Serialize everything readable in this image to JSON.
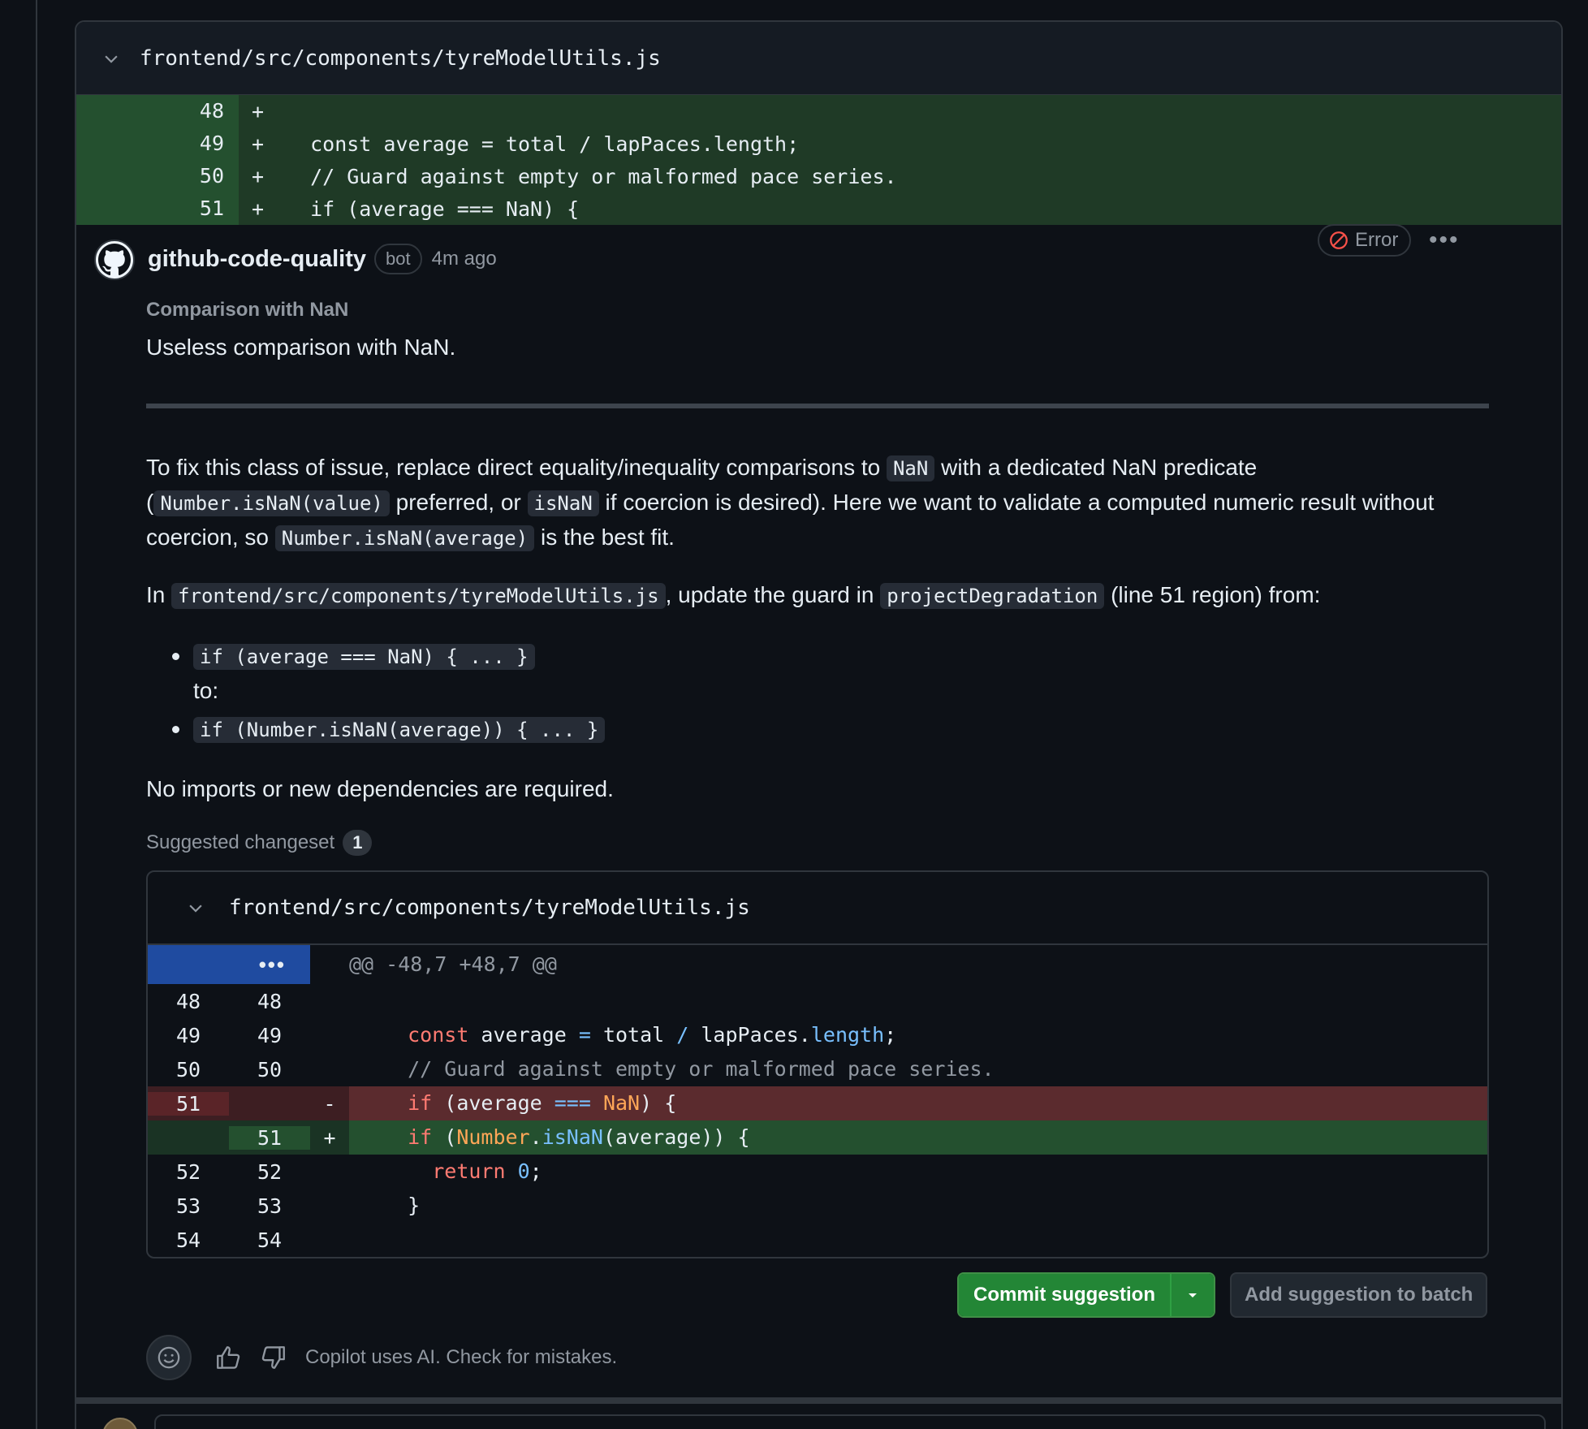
{
  "file": {
    "path": "frontend/src/components/tyreModelUtils.js"
  },
  "context_diff": [
    {
      "ln": "48",
      "sign": "+",
      "code": ""
    },
    {
      "ln": "49",
      "sign": "+",
      "code": "  const average = total / lapPaces.length;"
    },
    {
      "ln": "50",
      "sign": "+",
      "code": "  // Guard against empty or malformed pace series."
    },
    {
      "ln": "51",
      "sign": "+",
      "code": "  if (average === NaN) {"
    }
  ],
  "comment": {
    "author": "github-code-quality",
    "badge": "bot",
    "time": "4m ago",
    "severity": "Error",
    "more": "•••",
    "rule_title": "Comparison with NaN",
    "rule_desc": "Useless comparison with NaN.",
    "para1_a": "To fix this class of issue, replace direct equality/inequality comparisons to ",
    "para1_code1": "NaN",
    "para1_b": " with a dedicated NaN predicate (",
    "para1_code2": "Number.isNaN(value)",
    "para1_c": " preferred, or ",
    "para1_code3": "isNaN",
    "para1_d": " if coercion is desired). Here we want to validate a computed numeric result without coercion, so ",
    "para1_code4": "Number.isNaN(average)",
    "para1_e": " is the best fit.",
    "para2_a": "In ",
    "para2_code1": "frontend/src/components/tyreModelUtils.js",
    "para2_b": ", update the guard in ",
    "para2_code2": "projectDegradation",
    "para2_c": " (line 51 region) from:",
    "bullet1_code": "if (average === NaN) { ... }",
    "bullet1_sub": "to:",
    "bullet2_code": "if (Number.isNaN(average)) { ... }",
    "para3": "No imports or new dependencies are required.",
    "suggested_label": "Suggested changeset",
    "suggested_count": "1"
  },
  "suggestion": {
    "path": "frontend/src/components/tyreModelUtils.js",
    "hunk_dots": "•••",
    "hunk_header": "@@ -48,7 +48,7 @@",
    "rows": [
      {
        "old": "48",
        "new": "48",
        "sign": "",
        "type": "ctx"
      },
      {
        "old": "49",
        "new": "49",
        "sign": "",
        "type": "ctx"
      },
      {
        "old": "50",
        "new": "50",
        "sign": "",
        "type": "ctx"
      },
      {
        "old": "51",
        "new": "",
        "sign": "-",
        "type": "del"
      },
      {
        "old": "",
        "new": "51",
        "sign": "+",
        "type": "add"
      },
      {
        "old": "52",
        "new": "52",
        "sign": "",
        "type": "ctx"
      },
      {
        "old": "53",
        "new": "53",
        "sign": "",
        "type": "ctx"
      },
      {
        "old": "54",
        "new": "54",
        "sign": "",
        "type": "ctx"
      }
    ],
    "code": {
      "l49_kw": "const",
      "l49_a": " average ",
      "l49_op1": "=",
      "l49_b": " total ",
      "l49_op2": "/",
      "l49_c": " lapPaces.",
      "l49_prop": "length",
      "l49_d": ";",
      "l50": "// Guard against empty or malformed pace series.",
      "l51d_kw": "if",
      "l51d_a": " (average ",
      "l51d_op": "===",
      "l51d_nan": " NaN",
      "l51d_b": ") {",
      "l51a_kw": "if",
      "l51a_a": " (",
      "l51a_cls": "Number",
      "l51a_dot": ".",
      "l51a_fn": "isNaN",
      "l51a_b": "(average)) {",
      "l52_kw": "return",
      "l52_num": " 0",
      "l52_end": ";",
      "l53": "}"
    }
  },
  "buttons": {
    "commit": "Commit suggestion",
    "batch": "Add suggestion to batch"
  },
  "footer": {
    "disclaimer": "Copilot uses AI. Check for mistakes."
  },
  "colors": {
    "accent_green": "#238636",
    "error_red": "#f85149",
    "background": "#0d1117"
  }
}
